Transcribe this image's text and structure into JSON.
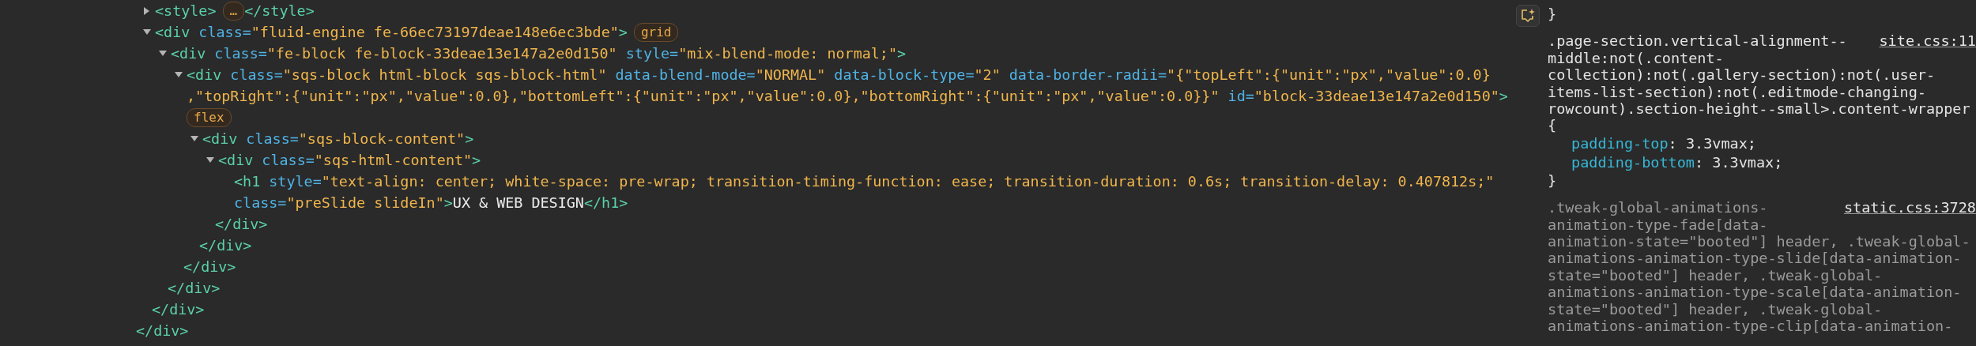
{
  "elements_panel": {
    "tree": [
      {
        "kind": "container",
        "expanded": false,
        "lines": [
          [
            {
              "kind": "tag",
              "text": "<style>"
            },
            {
              "kind": "badge",
              "text": "…"
            },
            {
              "kind": "tag",
              "text": "</style>"
            }
          ]
        ]
      },
      {
        "kind": "container",
        "expanded": true,
        "lines": [
          [
            {
              "kind": "tag",
              "text": "<div"
            },
            {
              "kind": "attr",
              "text": "class="
            },
            {
              "kind": "value",
              "text": "\"fluid-engine fe-66ec73197deae148e6ec3bde\""
            },
            {
              "kind": "tag",
              "text": ">"
            },
            {
              "kind": "badge",
              "text": "grid"
            }
          ]
        ],
        "children": [
          {
            "kind": "container",
            "expanded": true,
            "lines": [
              [
                {
                  "kind": "tag",
                  "text": "<div"
                },
                {
                  "kind": "attr",
                  "text": "class="
                },
                {
                  "kind": "value",
                  "text": "\"fe-block fe-block-33deae13e147a2e0d150\""
                },
                {
                  "kind": "attr",
                  "text": "style="
                },
                {
                  "kind": "value",
                  "text": "\"mix-blend-mode: normal;\""
                },
                {
                  "kind": "tag",
                  "text": ">"
                }
              ]
            ],
            "children": [
              {
                "kind": "container",
                "expanded": true,
                "lines": [
                  [
                    {
                      "kind": "tag",
                      "text": "<div"
                    },
                    {
                      "kind": "attr",
                      "text": "class="
                    },
                    {
                      "kind": "value",
                      "text": "\"sqs-block html-block sqs-block-html\""
                    },
                    {
                      "kind": "attr",
                      "text": "data-blend-mode="
                    },
                    {
                      "kind": "value",
                      "text": "\"NORMAL\""
                    },
                    {
                      "kind": "attr",
                      "text": "data-block-type="
                    },
                    {
                      "kind": "value",
                      "text": "\"2\""
                    },
                    {
                      "kind": "attr",
                      "text": "data-border-radii="
                    },
                    {
                      "kind": "value",
                      "text": "\"{\"topLeft\":{\"unit\":\"px\",\"value\":0.0}"
                    }
                  ],
                  [
                    {
                      "kind": "value",
                      "text": ",\"topRight\":{\"unit\":\"px\",\"value\":0.0},\"bottomLeft\":{\"unit\":\"px\",\"value\":0.0},\"bottomRight\":{\"unit\":\"px\",\"value\":0.0}}\""
                    },
                    {
                      "kind": "attr",
                      "text": "id="
                    },
                    {
                      "kind": "value",
                      "text": "\"block-33deae13e147a2e0d150\""
                    },
                    {
                      "kind": "tag",
                      "text": ">"
                    }
                  ],
                  [
                    {
                      "kind": "badge",
                      "text": "flex"
                    }
                  ]
                ],
                "children": [
                  {
                    "kind": "container",
                    "expanded": true,
                    "lines": [
                      [
                        {
                          "kind": "tag",
                          "text": "<div"
                        },
                        {
                          "kind": "attr",
                          "text": "class="
                        },
                        {
                          "kind": "value",
                          "text": "\"sqs-block-content\""
                        },
                        {
                          "kind": "tag",
                          "text": ">"
                        }
                      ]
                    ],
                    "children": [
                      {
                        "kind": "container",
                        "expanded": true,
                        "lines": [
                          [
                            {
                              "kind": "tag",
                              "text": "<div"
                            },
                            {
                              "kind": "attr",
                              "text": "class="
                            },
                            {
                              "kind": "value",
                              "text": "\"sqs-html-content\""
                            },
                            {
                              "kind": "tag",
                              "text": ">"
                            }
                          ]
                        ],
                        "children": [
                          {
                            "kind": "leaf",
                            "lines": [
                              [
                                {
                                  "kind": "tag",
                                  "text": "<h1"
                                },
                                {
                                  "kind": "attr",
                                  "text": "style="
                                },
                                {
                                  "kind": "value",
                                  "text": "\"text-align: center; white-space: pre-wrap; transition-timing-function: ease; transition-duration: 0.6s; transition-delay: 0.407812s;\""
                                }
                              ],
                              [
                                {
                                  "kind": "attr",
                                  "text": "class="
                                },
                                {
                                  "kind": "value",
                                  "text": "\"preSlide slideIn\""
                                },
                                {
                                  "kind": "tag",
                                  "text": ">"
                                },
                                {
                                  "kind": "text",
                                  "text": "UX & WEB DESIGN"
                                },
                                {
                                  "kind": "tag",
                                  "text": "</h1>"
                                }
                              ]
                            ]
                          }
                        ],
                        "close": "</div>"
                      }
                    ],
                    "close": "</div>"
                  }
                ],
                "close": "</div>"
              }
            ],
            "close": "</div>"
          }
        ],
        "close": "</div>"
      }
    ],
    "outer_close": "</div>"
  },
  "styles_panel": {
    "rules": [
      {
        "matched": true,
        "close": "}"
      },
      {
        "matched": true,
        "source": "site.css:11",
        "selector_lines": [
          ".page-section.vertical-alignment--",
          "middle:not(.content-",
          "collection):not(.gallery-section):not(.user-",
          "items-list-section):not(.editmode-changing-",
          "rowcount).section-height--small>.content-wrapper"
        ],
        "open": "{",
        "declarations": [
          {
            "property": "padding-top",
            "separator": ":",
            "value": "3.3vmax;"
          },
          {
            "property": "padding-bottom",
            "separator": ":",
            "value": "3.3vmax;"
          }
        ],
        "close": "}"
      },
      {
        "matched": false,
        "source": "static.css:3728",
        "selector_lines": [
          ".tweak-global-animations-",
          "animation-type-fade[data-",
          "animation-state=\"booted\"] header, .tweak-global-",
          "animations-animation-type-slide[data-animation-",
          "state=\"booted\"] header, .tweak-global-",
          "animations-animation-type-scale[data-animation-",
          "state=\"booted\"] header, .tweak-global-",
          "animations-animation-type-clip[data-animation-"
        ]
      }
    ]
  }
}
